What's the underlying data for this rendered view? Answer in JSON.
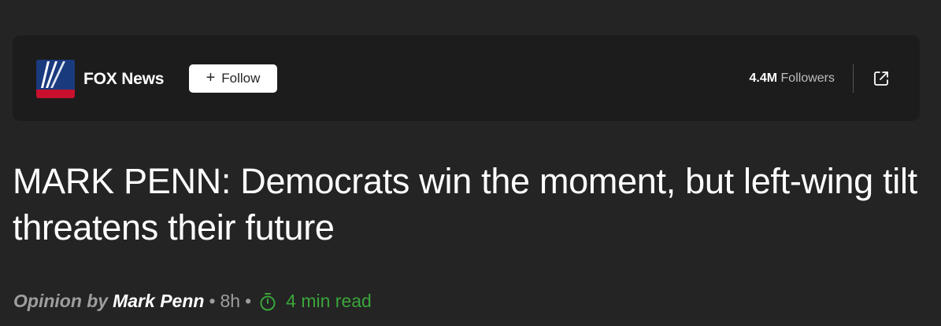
{
  "publisher": {
    "name": "FOX News",
    "logo_icon": "fox-news-logo",
    "follow_label": "Follow",
    "follow_icon": "plus-icon",
    "followers_count": "4.4M",
    "followers_label": "Followers",
    "open_icon": "external-link-icon"
  },
  "article": {
    "headline": "MARK PENN: Democrats win the moment, but left-wing tilt threatens their future",
    "byline_prefix": "Opinion by",
    "author": "Mark Penn",
    "separator": "•",
    "age": "8h",
    "read_time": "4 min read",
    "read_icon": "timer-icon"
  },
  "colors": {
    "background": "#242424",
    "card": "#1c1c1c",
    "read_time": "#3aa53a",
    "logo_blue": "#1a3a7e",
    "logo_red": "#c8102e"
  }
}
